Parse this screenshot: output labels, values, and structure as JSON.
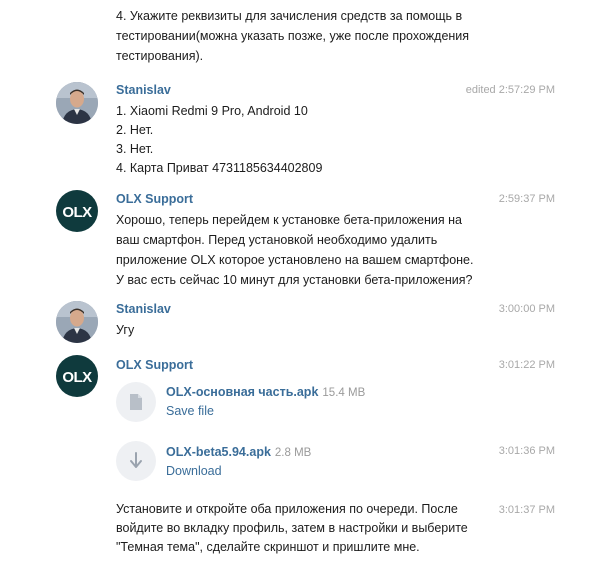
{
  "top_message": {
    "lines": [
      "4. Укажите реквизиты для зачисления средств за помощь в",
      "тестировании(можна указать позже, уже после прохождения",
      "тестирования)."
    ]
  },
  "messages": [
    {
      "sender": "Stanislav",
      "time": "edited 2:57:29 PM",
      "lines": [
        "1. Xiaomi Redmi 9 Pro, Android 10",
        "2. Нет.",
        "3. Нет.",
        "4. Карта Приват 4731185634402809"
      ]
    },
    {
      "sender": "OLX Support",
      "time": "2:59:37 PM",
      "lines": [
        "Хорошо, теперь перейдем к установке  бета-приложения на",
        "ваш смартфон. Перед установкой необходимо удалить",
        "приложение OLX которое установлено на вашем смартфоне.",
        "У вас есть сейчас 10 минут для установки бета-приложения?"
      ]
    },
    {
      "sender": "Stanislav",
      "time": "3:00:00 PM",
      "lines": [
        "Угу"
      ]
    },
    {
      "sender": "OLX Support",
      "time": "3:01:22 PM",
      "files": [
        {
          "name": "OLX-основная часть.apk",
          "size": "15.4 MB",
          "action": "Save file",
          "icon": "file-icon"
        },
        {
          "name": "OLX-beta5.94.apk",
          "size": "2.8 MB",
          "action": "Download",
          "icon": "download-icon",
          "time": "3:01:36 PM"
        }
      ],
      "followup": {
        "time": "3:01:37 PM",
        "lines": [
          "Установите и откройте оба приложения по очереди. После",
          "войдите во вкладку профиль, затем в настройки и выберите",
          "\"Темная тема\", сделайте скриншот и пришлите мне."
        ]
      }
    }
  ],
  "olx_logo": "OLX",
  "colors": {
    "name": "#3a6d99",
    "time": "#a8a8a8",
    "olx_bg": "#0f3a3d",
    "file_bg": "#eef0f3"
  }
}
